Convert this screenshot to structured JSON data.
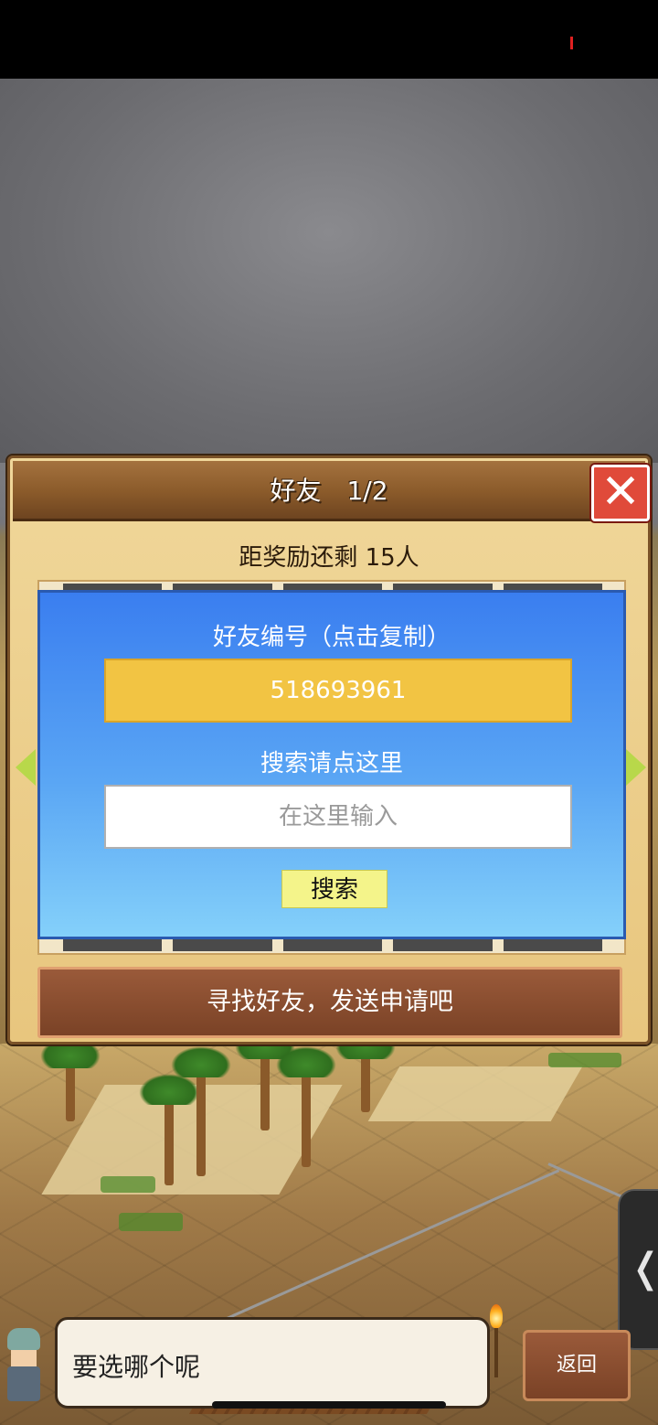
{
  "dialog": {
    "title": "好友　1/2",
    "remaining_text": "距奖励还剩 15人",
    "close_icon": "close-x-icon",
    "friend_id_label": "好友编号（点击复制）",
    "friend_id": "518693961",
    "search_label": "搜索请点这里",
    "search_placeholder": "在这里输入",
    "search_button": "搜索",
    "action_label": "寻找好友，发送申请吧",
    "nav": {
      "left_icon": "arrow-left-icon",
      "right_icon": "arrow-right-icon"
    }
  },
  "bottom": {
    "npc_message": "要选哪个呢",
    "back_button": "返回"
  },
  "side_handle": {
    "glyph": "❬"
  },
  "colors": {
    "panel_blue": "#3a7ef0",
    "id_box": "#f2c443",
    "search_button": "#f4f48a",
    "action_bar": "#7a4226",
    "close_red": "#e04a3a"
  }
}
